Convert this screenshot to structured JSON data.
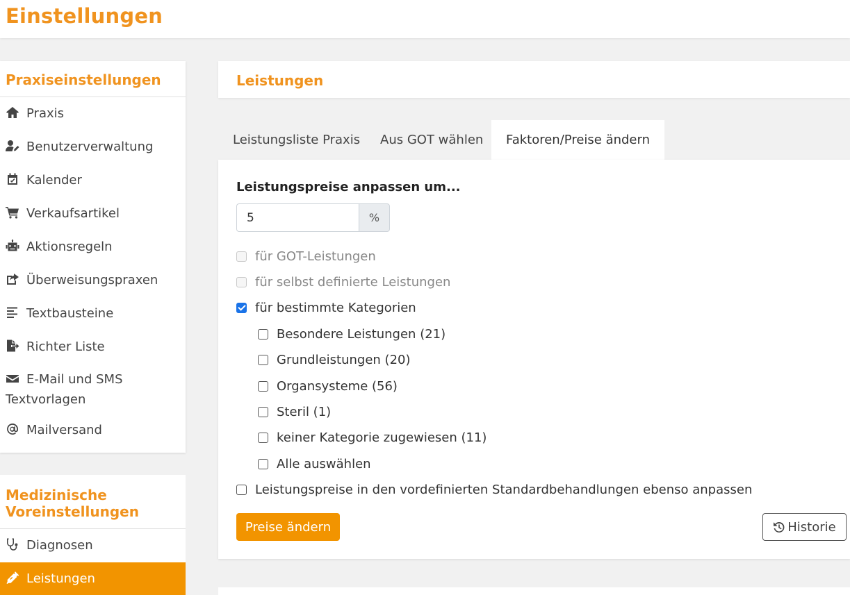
{
  "header": {
    "title": "Einstellungen"
  },
  "sidebar": {
    "section1": {
      "title": "Praxiseinstellungen",
      "items": [
        {
          "label": "Praxis",
          "icon": "home-icon"
        },
        {
          "label": "Benutzerverwaltung",
          "icon": "user-edit-icon"
        },
        {
          "label": "Kalender",
          "icon": "calendar-icon"
        },
        {
          "label": "Verkaufsartikel",
          "icon": "cart-icon"
        },
        {
          "label": "Aktionsregeln",
          "icon": "robot-icon"
        },
        {
          "label": "Überweisungspraxen",
          "icon": "share-icon"
        },
        {
          "label": "Textbausteine",
          "icon": "align-left-icon"
        },
        {
          "label": "Richter Liste",
          "icon": "file-export-icon"
        },
        {
          "label": "E-Mail und SMS Textvorlagen",
          "icon": "envelope-icon"
        },
        {
          "label": "Mailversand",
          "icon": "at-icon"
        }
      ]
    },
    "section2": {
      "title": "Medizinische Voreinstellungen",
      "items": [
        {
          "label": "Diagnosen",
          "icon": "stethoscope-icon"
        },
        {
          "label": "Leistungen",
          "icon": "syringe-icon",
          "active": true
        }
      ]
    }
  },
  "main": {
    "title": "Leistungen",
    "tabs": [
      {
        "label": "Leistungsliste Praxis"
      },
      {
        "label": "Aus GOT wählen"
      },
      {
        "label": "Faktoren/Preise ändern",
        "active": true
      }
    ],
    "form": {
      "adjust_label": "Leistungspreise anpassen um...",
      "percent_value": "5",
      "percent_unit": "%",
      "options": [
        {
          "label": "für GOT-Leistungen",
          "checked": false,
          "disabled": true
        },
        {
          "label": "für selbst definierte Leistungen",
          "checked": false,
          "disabled": true
        },
        {
          "label": "für bestimmte Kategorien",
          "checked": true,
          "disabled": false
        }
      ],
      "categories": [
        {
          "label": "Besondere Leistungen (21)",
          "checked": false
        },
        {
          "label": "Grundleistungen (20)",
          "checked": false
        },
        {
          "label": "Organsysteme (56)",
          "checked": false
        },
        {
          "label": "Steril (1)",
          "checked": false
        },
        {
          "label": "keiner Kategorie zugewiesen (11)",
          "checked": false
        },
        {
          "label": "Alle auswählen",
          "checked": false
        }
      ],
      "standard_option": {
        "label": "Leistungspreise in den vordefinierten Standardbehandlungen ebenso anpassen",
        "checked": false
      },
      "submit_label": "Preise ändern",
      "history_label": "Historie"
    }
  },
  "colors": {
    "accent": "#f0931f",
    "active_bg": "#f29400",
    "checkbox_checked": "#1a73e8"
  }
}
